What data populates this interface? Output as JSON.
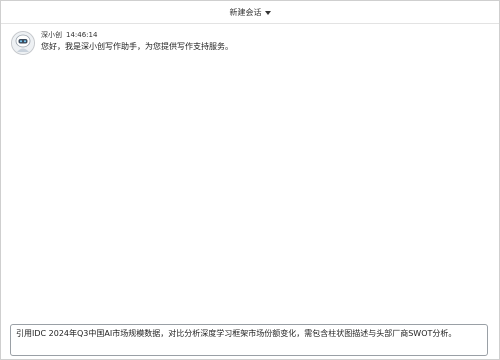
{
  "header": {
    "new_session_label": "新建会话"
  },
  "messages": [
    {
      "sender": "深小创",
      "time": "14:46:14",
      "text": "您好，我是深小创写作助手，为您提供写作支持服务。"
    }
  ],
  "input": {
    "value": "引用IDC 2024年Q3中国AI市场规模数据，对比分析深度学习框架市场份额变化，需包含柱状图描述与头部厂商SWOT分析。"
  },
  "colors": {
    "border": "#cfcfcf",
    "input_border": "#9aa0a6",
    "text": "#222222"
  }
}
